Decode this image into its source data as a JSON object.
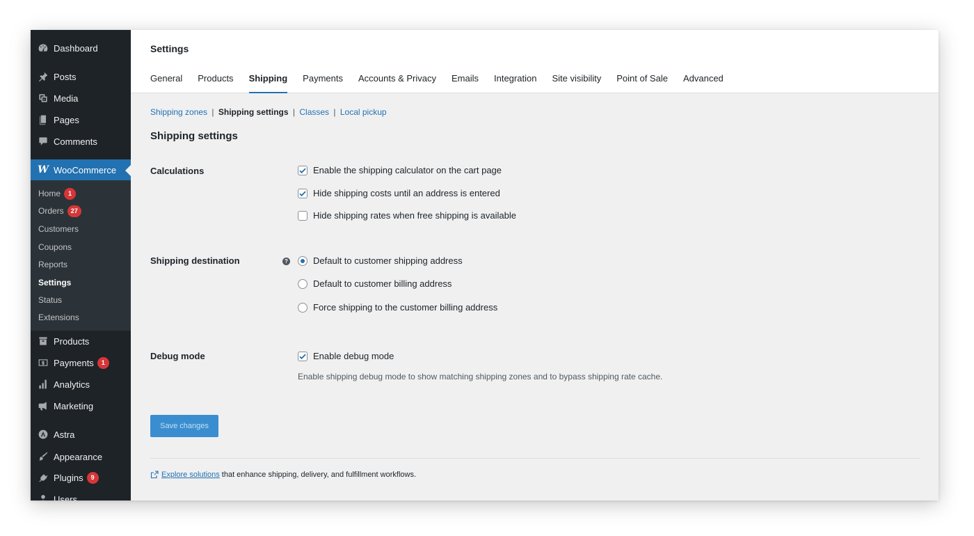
{
  "sidebar": {
    "top_items": [
      {
        "label": "Dashboard",
        "icon": "dashboard-icon"
      },
      {
        "label": "Posts",
        "icon": "pin-icon"
      },
      {
        "label": "Media",
        "icon": "media-icon"
      },
      {
        "label": "Pages",
        "icon": "pages-icon"
      },
      {
        "label": "Comments",
        "icon": "comment-icon"
      }
    ],
    "woocommerce": {
      "label": "WooCommerce",
      "icon": "woocommerce-icon",
      "logo_text": "W"
    },
    "submenu": [
      {
        "label": "Home",
        "badge": "1"
      },
      {
        "label": "Orders",
        "badge": "27"
      },
      {
        "label": "Customers"
      },
      {
        "label": "Coupons"
      },
      {
        "label": "Reports"
      },
      {
        "label": "Settings",
        "current": true
      },
      {
        "label": "Status"
      },
      {
        "label": "Extensions"
      }
    ],
    "bottom_items": [
      {
        "label": "Products",
        "icon": "archive-icon"
      },
      {
        "label": "Payments",
        "icon": "money-icon",
        "badge": "1"
      },
      {
        "label": "Analytics",
        "icon": "bar-chart-icon"
      },
      {
        "label": "Marketing",
        "icon": "megaphone-icon"
      },
      {
        "label": "Astra",
        "icon": "astra-icon"
      },
      {
        "label": "Appearance",
        "icon": "paintbrush-icon"
      },
      {
        "label": "Plugins",
        "icon": "plug-icon",
        "badge": "9"
      },
      {
        "label": "Users",
        "icon": "user-icon"
      }
    ]
  },
  "header": {
    "title": "Settings",
    "tabs": [
      "General",
      "Products",
      "Shipping",
      "Payments",
      "Accounts & Privacy",
      "Emails",
      "Integration",
      "Site visibility",
      "Point of Sale",
      "Advanced"
    ],
    "active_tab": "Shipping"
  },
  "subnav": {
    "zones": "Shipping zones",
    "settings": "Shipping settings",
    "classes": "Classes",
    "pickup": "Local pickup",
    "separator": "|"
  },
  "section_title": "Shipping settings",
  "calculations": {
    "label": "Calculations",
    "options": [
      {
        "label": "Enable the shipping calculator on the cart page",
        "checked": true
      },
      {
        "label": "Hide shipping costs until an address is entered",
        "checked": true
      },
      {
        "label": "Hide shipping rates when free shipping is available",
        "checked": false
      }
    ]
  },
  "destination": {
    "label": "Shipping destination",
    "help_icon": "help-icon",
    "options": [
      {
        "label": "Default to customer shipping address",
        "selected": true
      },
      {
        "label": "Default to customer billing address",
        "selected": false
      },
      {
        "label": "Force shipping to the customer billing address",
        "selected": false
      }
    ]
  },
  "debug": {
    "label": "Debug mode",
    "option": {
      "label": "Enable debug mode",
      "checked": true
    },
    "description": "Enable shipping debug mode to show matching shipping zones and to bypass shipping rate cache."
  },
  "save_button": "Save changes",
  "footer": {
    "link": "Explore solutions",
    "text": "that enhance shipping, delivery, and fulfillment workflows.",
    "icon": "external-link-icon"
  },
  "colors": {
    "sidebar_bg": "#1d2327",
    "accent": "#2271b1",
    "badge": "#d63638",
    "content_bg": "#f0f0f1"
  }
}
